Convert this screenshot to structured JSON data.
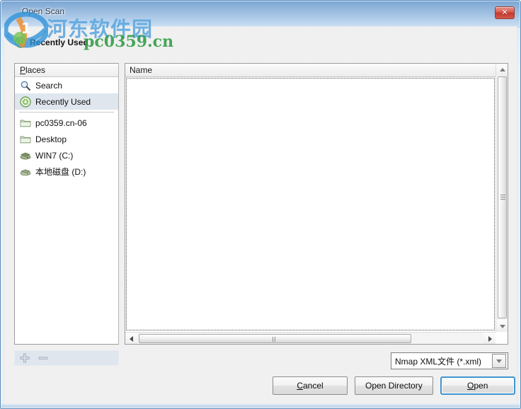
{
  "window": {
    "title": "Open Scan",
    "close_label": "✕",
    "close_icon": "close-icon"
  },
  "watermark": {
    "site_name": "河东软件园",
    "site_url": "pc0359.cn",
    "site_name_color": "#5fa8e0",
    "site_url_color": "#2f9b42",
    "logo_icon": "site-logo-icon"
  },
  "pathbar": {
    "icon": "recently-used-icon",
    "current_label": "Recently Used"
  },
  "places": {
    "header": "Places",
    "header_mnemonic": "P",
    "items": [
      {
        "label": "Search",
        "icon": "search-icon",
        "selected": false,
        "separator_after": false
      },
      {
        "label": "Recently Used",
        "icon": "recently-used-icon",
        "selected": true,
        "separator_after": true
      },
      {
        "label": "pc0359.cn-06",
        "icon": "folder-icon",
        "selected": false,
        "separator_after": false
      },
      {
        "label": "Desktop",
        "icon": "folder-icon",
        "selected": false,
        "separator_after": false
      },
      {
        "label": "WIN7 (C:)",
        "icon": "hard-drive-icon",
        "selected": false,
        "separator_after": false
      },
      {
        "label": "本地磁盘 (D:)",
        "icon": "hard-drive-icon",
        "selected": false,
        "separator_after": false
      }
    ],
    "tools": [
      {
        "name": "add-place-button",
        "icon": "plus-icon",
        "label": "+"
      },
      {
        "name": "remove-place-button",
        "icon": "minus-icon",
        "label": "−"
      }
    ]
  },
  "filelist": {
    "columns": [
      "Name"
    ],
    "rows": [],
    "vertical_scrollbar": {
      "up_arrow": "arrow-up-icon",
      "down_arrow": "arrow-down-icon",
      "thumb": "scrollbar-thumb"
    },
    "horizontal_scrollbar": {
      "left_arrow": "arrow-left-icon",
      "right_arrow": "arrow-right-icon",
      "thumb": "scrollbar-thumb"
    }
  },
  "filter": {
    "selected": "Nmap XML文件 (*.xml)",
    "arrow_icon": "chevron-down-icon"
  },
  "buttons": {
    "cancel": {
      "text": "Cancel",
      "mnemonic": "C",
      "default": false
    },
    "open_directory": {
      "text": "Open Directory",
      "mnemonic": "",
      "default": false
    },
    "open": {
      "text": "Open",
      "mnemonic": "O",
      "default": true
    }
  },
  "colors": {
    "titlebar_top": "#7ca7d4",
    "titlebar_bottom": "#cde0f3",
    "close_red": "#c4382c",
    "selection": "#dfe6ee",
    "focus_ring": "#3e95d0"
  }
}
